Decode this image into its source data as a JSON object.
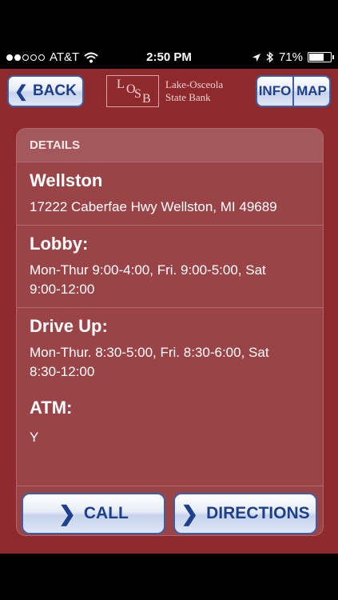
{
  "status_bar": {
    "carrier": "AT&T",
    "time": "2:50 PM",
    "battery": "71%",
    "battery_level": 0.71,
    "signal_bars_filled": 2,
    "signal_bars_total": 5
  },
  "nav": {
    "back_label": "BACK",
    "logo_letters": [
      "L",
      "O",
      "S",
      "B"
    ],
    "logo_line1": "Lake-Osceola",
    "logo_line2": "State Bank",
    "info_label": "INFO",
    "map_label": "MAP"
  },
  "details": {
    "header": "DETAILS",
    "name": "Wellston",
    "address": "17222 Caberfae Hwy Wellston, MI 49689",
    "lobby_title": "Lobby:",
    "lobby_hours_line1": "Mon-Thur 9:00-4:00, Fri. 9:00-5:00, Sat",
    "lobby_hours_line2": "9:00-12:00",
    "drive_title": "Drive Up:",
    "drive_hours_line1": "Mon-Thur. 8:30-5:00, Fri. 8:30-6:00, Sat",
    "drive_hours_line2": "8:30-12:00",
    "atm_title": "ATM:",
    "atm_value": "Y"
  },
  "actions": {
    "call_label": "CALL",
    "directions_label": "DIRECTIONS"
  },
  "colors": {
    "background": "#8e2a2e",
    "panel": "#9b4448",
    "button_text": "#1e3f8c"
  }
}
